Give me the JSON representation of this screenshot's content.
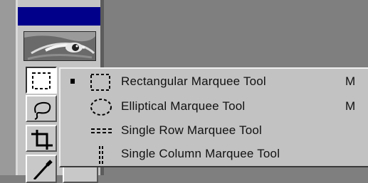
{
  "toolbox": {
    "tools": [
      {
        "name": "rectangular-marquee",
        "icon": "rect-marquee-icon",
        "selected": true
      },
      {
        "name": "lasso",
        "icon": "lasso-icon",
        "selected": false
      },
      {
        "name": "crop",
        "icon": "crop-icon",
        "selected": false
      },
      {
        "name": "brush",
        "icon": "brush-icon",
        "selected": false
      }
    ],
    "title_bar_color": "#00008a",
    "logo_icon": "eye-logo-icon"
  },
  "flyout": {
    "items": [
      {
        "label": "Rectangular Marquee Tool",
        "shortcut": "M",
        "checked": true,
        "icon": "rect-marquee-icon"
      },
      {
        "label": "Elliptical Marquee Tool",
        "shortcut": "M",
        "checked": false,
        "icon": "ellipse-marquee-icon"
      },
      {
        "label": "Single Row Marquee Tool",
        "shortcut": "",
        "checked": false,
        "icon": "single-row-marquee-icon"
      },
      {
        "label": "Single Column Marquee Tool",
        "shortcut": "",
        "checked": false,
        "icon": "single-column-marquee-icon"
      }
    ]
  }
}
